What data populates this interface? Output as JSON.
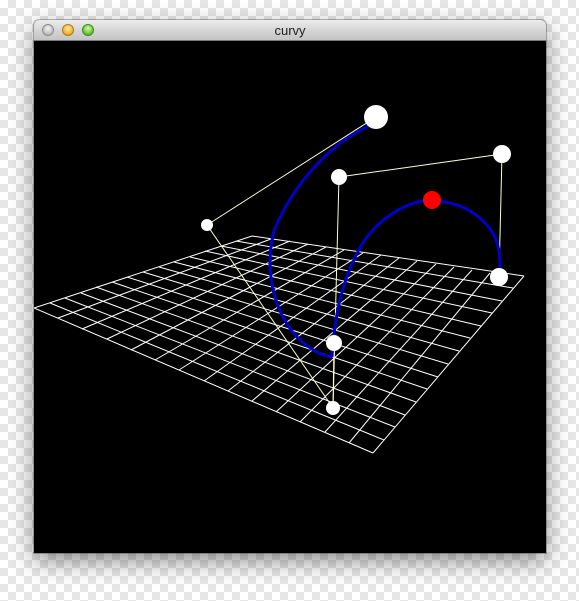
{
  "window": {
    "title": "curvy"
  },
  "colors": {
    "background": "#000000",
    "grid": "#ffffff",
    "control_polygon": "#ffffcc",
    "curve": "#0000cc",
    "control_point": "#ffffff",
    "selected_point": "#ff0000"
  },
  "icons": {
    "close": "close-button",
    "minimize": "minimize-button",
    "zoom": "zoom-button"
  }
}
